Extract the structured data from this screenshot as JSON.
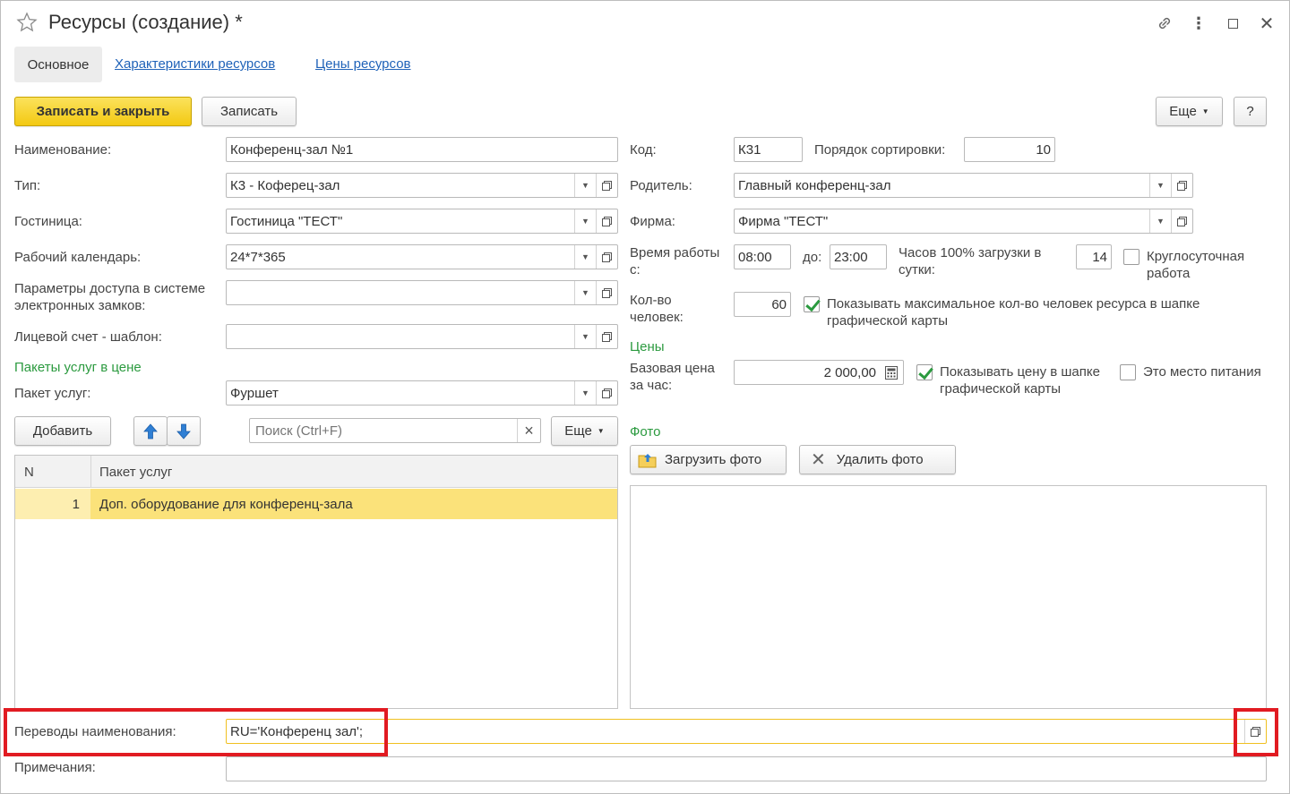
{
  "window": {
    "title": "Ресурсы (создание) *"
  },
  "tabs": {
    "main": "Основное",
    "characteristics": "Характеристики ресурсов",
    "prices": "Цены ресурсов"
  },
  "toolbar": {
    "save_close": "Записать и закрыть",
    "save": "Записать",
    "more": "Еще",
    "help": "?"
  },
  "left": {
    "name_label": "Наименование:",
    "name_value": "Конференц-зал №1",
    "type_label": "Тип:",
    "type_value": "К3 - Коферец-зал",
    "hotel_label": "Гостиница:",
    "hotel_value": "Гостиница \"ТЕСТ\"",
    "calendar_label": "Рабочий календарь:",
    "calendar_value": "24*7*365",
    "locks_label": "Параметры доступа в системе электронных замков:",
    "locks_value": "",
    "account_label": "Лицевой счет - шаблон:",
    "account_value": "",
    "packages_section": "Пакеты услуг в цене",
    "package_label": "Пакет услуг:",
    "package_value": "Фуршет"
  },
  "list_toolbar": {
    "add": "Добавить",
    "search_placeholder": "Поиск (Ctrl+F)",
    "clear": "×",
    "more": "Еще"
  },
  "table": {
    "columns": [
      "N",
      "Пакет услуг"
    ],
    "rows": [
      {
        "n": "1",
        "name": "Доп. оборудование для конференц-зала"
      }
    ]
  },
  "right": {
    "code_label": "Код:",
    "code_value": "К31",
    "sort_label": "Порядок сортировки:",
    "sort_value": "10",
    "parent_label": "Родитель:",
    "parent_value": "Главный конференц-зал",
    "company_label": "Фирма:",
    "company_value": "Фирма \"ТЕСТ\"",
    "worktime_label": "Время работы с:",
    "worktime_from": "08:00",
    "worktime_to_label": "до:",
    "worktime_to": "23:00",
    "hours_label": "Часов 100% загрузки в сутки:",
    "hours_value": "14",
    "allday_label": "Круглосуточная работа",
    "people_label": "Кол-во человек:",
    "people_value": "60",
    "show_max_label": "Показывать максимальное кол-во человек ресурса в шапке графической карты",
    "prices_section": "Цены",
    "base_price_label": "Базовая цена за час:",
    "base_price_value": "2 000,00",
    "show_price_label": "Показывать цену в шапке графической карты",
    "food_label": "Это место питания",
    "photo_section": "Фото",
    "upload_photo": "Загрузить фото",
    "delete_photo": "Удалить фото"
  },
  "bottom": {
    "translations_label": "Переводы наименования:",
    "translations_value": "RU='Конференц зал';",
    "notes_label": "Примечания:",
    "notes_value": ""
  },
  "colors": {
    "accent_yellow": "#f3c912",
    "link_blue": "#1f62b8",
    "section_green": "#2b9a3f",
    "highlight_red": "#e11b22",
    "row_highlight": "#fbe27a"
  }
}
